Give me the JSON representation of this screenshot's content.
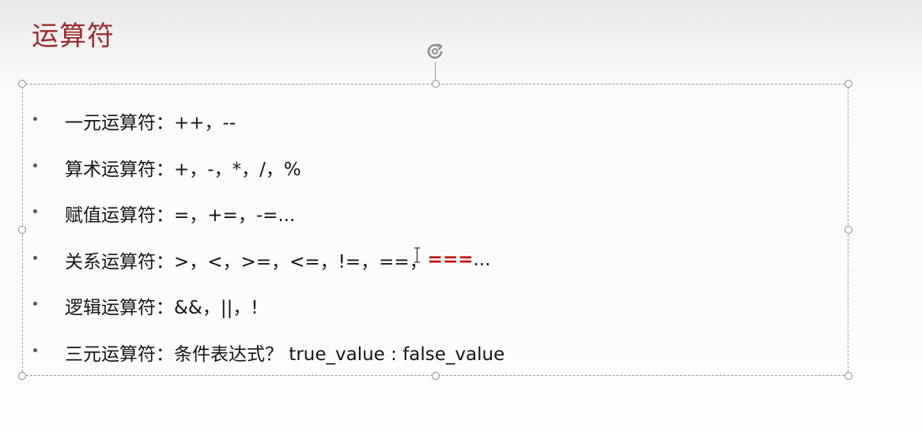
{
  "slide": {
    "title": "运算符"
  },
  "bullets": [
    {
      "label": "一元运算符：",
      "value": "++，--"
    },
    {
      "label": "算术运算符：",
      "value": "+，-，*，/，%"
    },
    {
      "label": "赋值运算符：",
      "value": "=，+=，-=..."
    },
    {
      "label": "关系运算符：",
      "value_before": ">，<，>=，<=，!=，==，",
      "highlight": "===",
      "value_after": "..."
    },
    {
      "label": "逻辑运算符：",
      "value": "&&，||，!"
    },
    {
      "label": "三元运算符：",
      "value": "条件表达式？ true_value : false_value"
    }
  ],
  "colors": {
    "title": "#9b2a2a",
    "highlight": "#c00000",
    "text": "#141414"
  },
  "icons": {
    "rotate": "rotate-handle-icon",
    "cursor": "text-cursor-icon"
  }
}
